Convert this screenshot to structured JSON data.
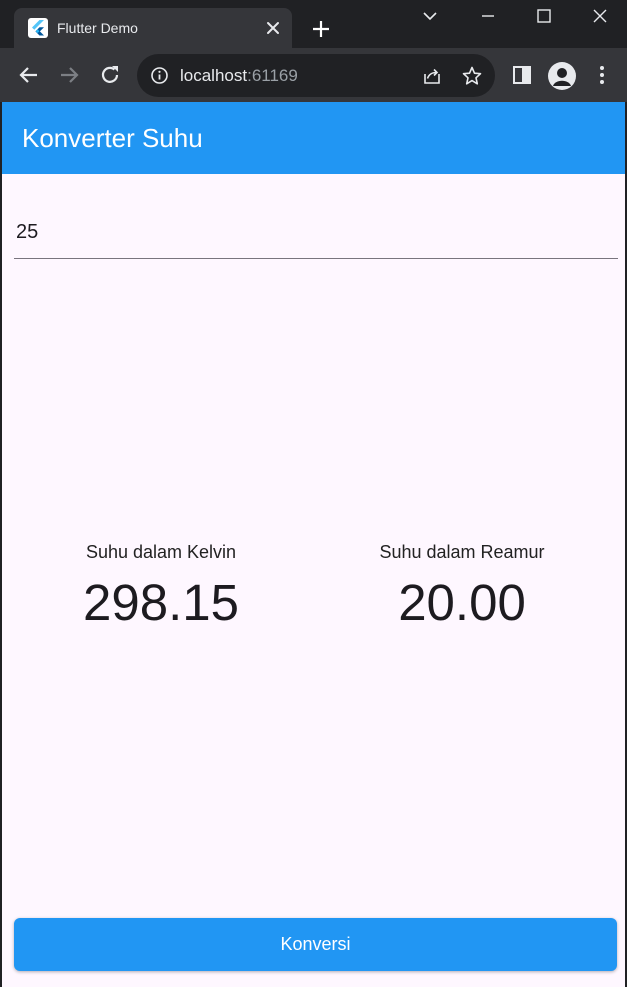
{
  "browser": {
    "tab": {
      "title": "Flutter Demo",
      "favicon": "flutter-logo"
    },
    "address_bar": {
      "host": "localhost",
      "port": ":61169"
    },
    "icons": {
      "back": "arrow-left-icon",
      "forward": "arrow-right-icon",
      "reload": "reload-icon",
      "info": "info-icon",
      "share": "share-icon",
      "bookmark": "star-icon",
      "side_panel": "side-panel-icon",
      "profile": "profile-avatar-icon",
      "menu": "kebab-menu-icon"
    }
  },
  "app": {
    "title": "Konverter Suhu",
    "input_value": "25",
    "results": [
      {
        "label": "Suhu dalam Kelvin",
        "value": "298.15"
      },
      {
        "label": "Suhu dalam Reamur",
        "value": "20.00"
      }
    ],
    "button_label": "Konversi"
  },
  "colors": {
    "primary": "#2196f3",
    "page_background": "#fef7ff",
    "browser_frame": "#202124",
    "browser_toolbar": "#35363a"
  }
}
